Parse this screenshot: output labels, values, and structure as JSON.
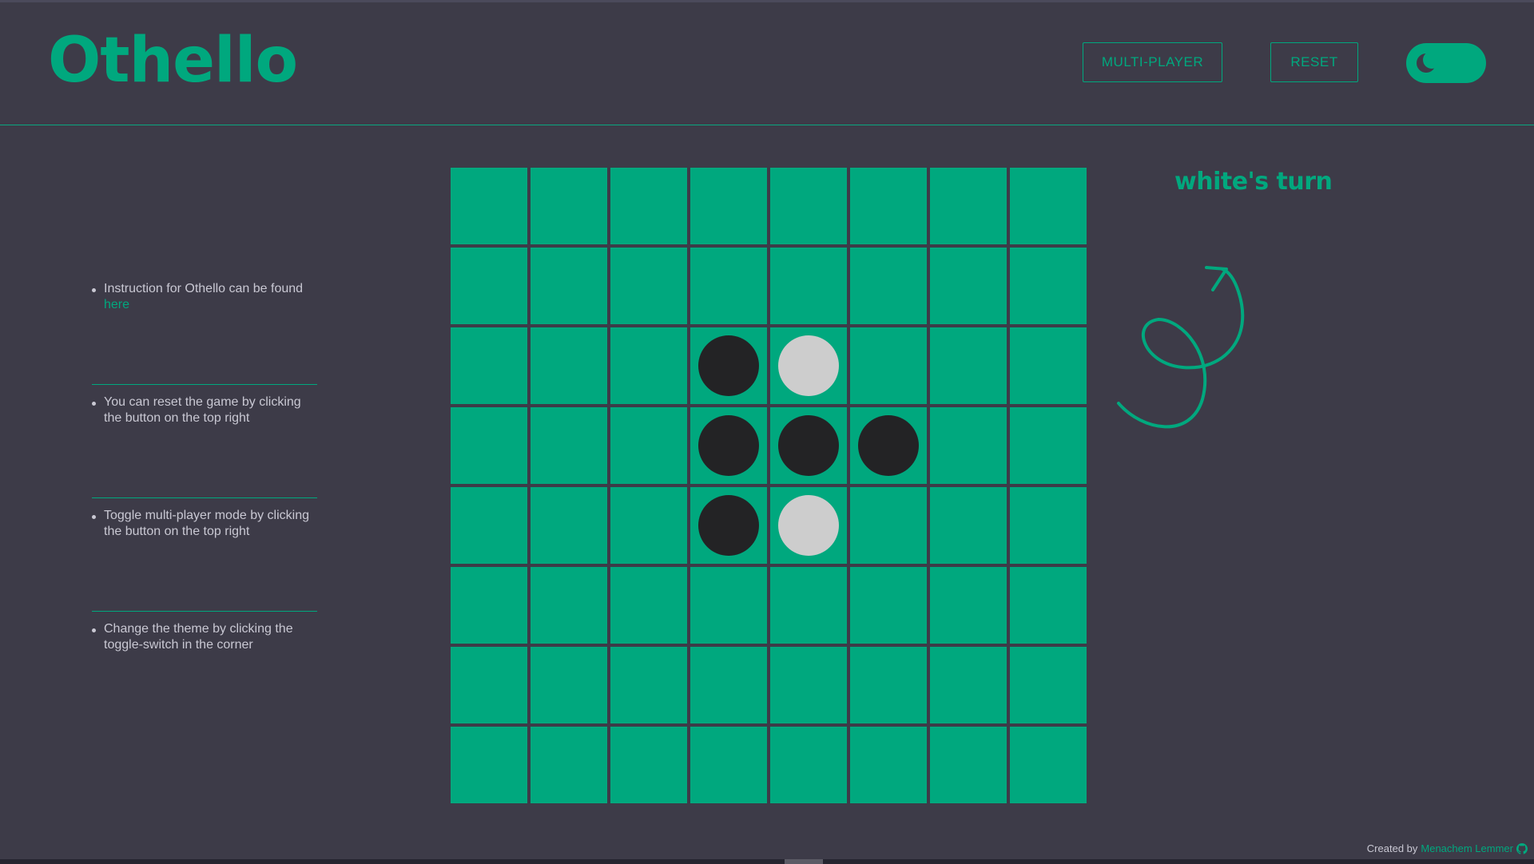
{
  "header": {
    "title": "Othello",
    "multiplayer_label": "MULTI-PLAYER",
    "reset_label": "RESET",
    "theme_toggle_icon": "moon-icon"
  },
  "instructions": [
    {
      "text": "Instruction for Othello can be found ",
      "link": "here"
    },
    {
      "text": "You can reset the game by clicking the button on the top right"
    },
    {
      "text": "Toggle multi-player mode by clicking the button on the top right"
    },
    {
      "text": "Change the theme by clicking the toggle-switch in the corner"
    }
  ],
  "game": {
    "status": "white's turn",
    "board": [
      [
        "",
        "",
        "",
        "",
        "",
        "",
        "",
        ""
      ],
      [
        "",
        "",
        "",
        "",
        "",
        "",
        "",
        ""
      ],
      [
        "",
        "",
        "",
        "B",
        "W",
        "",
        "",
        ""
      ],
      [
        "",
        "",
        "",
        "B",
        "B",
        "B",
        "",
        ""
      ],
      [
        "",
        "",
        "",
        "B",
        "W",
        "",
        "",
        ""
      ],
      [
        "",
        "",
        "",
        "",
        "",
        "",
        "",
        ""
      ],
      [
        "",
        "",
        "",
        "",
        "",
        "",
        "",
        ""
      ],
      [
        "",
        "",
        "",
        "",
        "",
        "",
        "",
        ""
      ]
    ]
  },
  "footer": {
    "prefix": "Created by",
    "author": "Menachem Lemmer",
    "icon": "github-icon"
  },
  "colors": {
    "accent": "#00a87e",
    "background": "#3d3b48",
    "black_disc": "#232325",
    "white_disc": "#cdcdcd"
  }
}
